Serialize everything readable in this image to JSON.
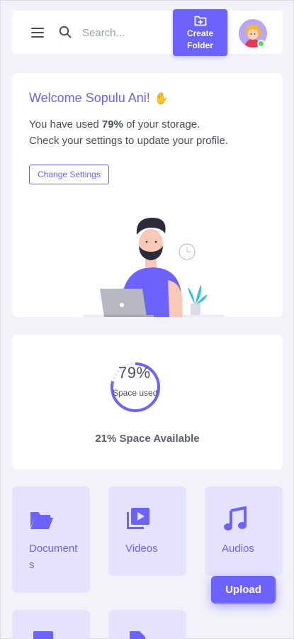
{
  "header": {
    "search_placeholder": "Search...",
    "create_folder_line1": "Create",
    "create_folder_line2": "Folder"
  },
  "welcome": {
    "title": "Welcome Sopulu Ani!",
    "usage_prefix": "You have used ",
    "usage_percent": "79%",
    "usage_suffix": " of your storage.",
    "settings_hint": "Check your settings to update your profile.",
    "change_settings_label": "Change Settings"
  },
  "storage": {
    "used_fraction": 0.79,
    "used_percent_label": "79%",
    "used_caption": "Space used",
    "available_label": "21% Space Available"
  },
  "categories": [
    {
      "label": "Documents",
      "icon": "folder-open-icon"
    },
    {
      "label": "Videos",
      "icon": "video-library-icon"
    },
    {
      "label": "Audios",
      "icon": "music-note-icon"
    },
    {
      "label": "",
      "icon": "image-icon"
    },
    {
      "label": "",
      "icon": "file-icon"
    }
  ],
  "upload_label": "Upload",
  "colors": {
    "accent": "#6c63ff",
    "tile_bg": "#e5e3fc",
    "page_bg": "#f2f2f8",
    "online": "#4cd964"
  }
}
